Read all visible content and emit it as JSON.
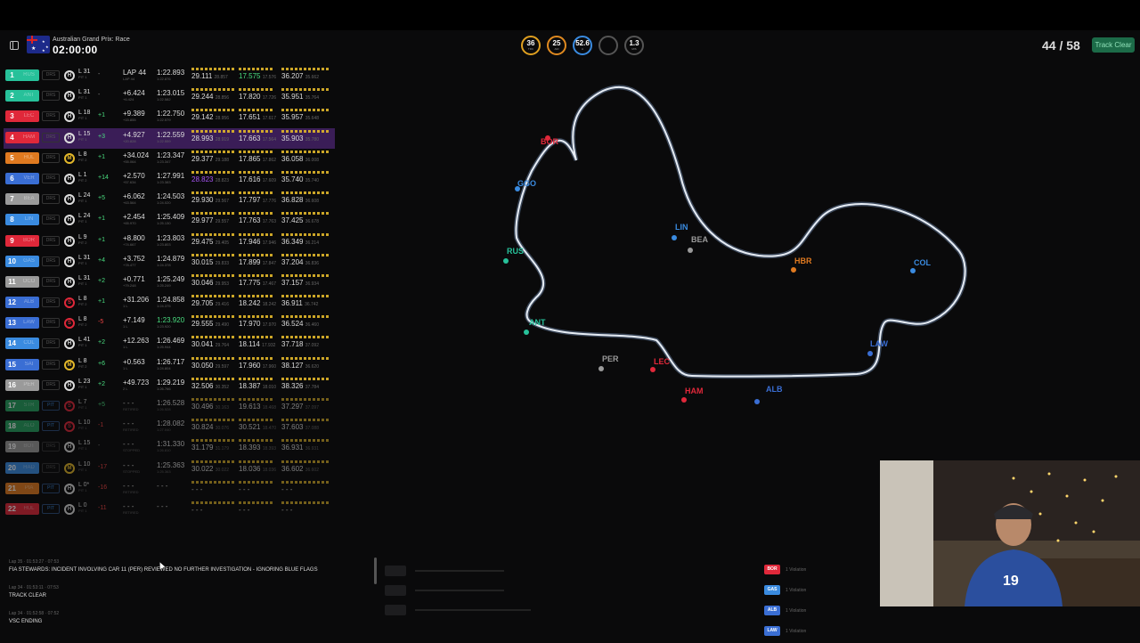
{
  "header": {
    "race_title": "Australian Grand Prix: Race",
    "clock": "02:00:00",
    "weather": [
      {
        "icon": "track-temp-icon",
        "value": "36",
        "unit": "TRC",
        "color": "#e0a020"
      },
      {
        "icon": "air-temp-icon",
        "value": "25",
        "unit": "AIR",
        "color": "#e08a20"
      },
      {
        "icon": "humidity-icon",
        "value": "52.6",
        "unit": "H",
        "color": "#3a8be0"
      },
      {
        "icon": "rain-icon",
        "value": "",
        "unit": "",
        "color": "#555555"
      },
      {
        "icon": "wind-icon",
        "value": "1.3",
        "unit": "M/S",
        "color": "#555555"
      }
    ],
    "laps": "44 / 58",
    "track_status": "Track Clear"
  },
  "drivers": [
    {
      "pos": "1",
      "code": "RUS",
      "color": "#27c19a",
      "drs": "DRS",
      "tyre": "H",
      "tyre_color": "#dddddd",
      "lap": "L 31",
      "lap_sub": "PIT 1",
      "delta": "-",
      "delta_color": "#888888",
      "gap": "LAP 44",
      "gap_sub": "LAP 44",
      "time": "1:22.893",
      "time_sub": "1:22.876",
      "s1": "29.111",
      "s1s": "28.857",
      "s2": "17.575",
      "s2s": "17.576",
      "s3": "36.207",
      "s3s": "35.662",
      "s2color": "#4ade80"
    },
    {
      "pos": "2",
      "code": "ANT",
      "color": "#27c19a",
      "drs": "DRS",
      "tyre": "H",
      "tyre_color": "#dddddd",
      "lap": "L 31",
      "lap_sub": "PIT 1",
      "delta": "-",
      "delta_color": "#888888",
      "gap": "+6.424",
      "gap_sub": "+6.424",
      "time": "1:23.015",
      "time_sub": "1:22.582",
      "s1": "29.244",
      "s1s": "28.856",
      "s2": "17.820",
      "s2s": "17.726",
      "s3": "35.951",
      "s3s": "35.764",
      "s2color": "#dddddd"
    },
    {
      "pos": "3",
      "code": "LEC",
      "color": "#e0283a",
      "drs": "DRS",
      "tyre": "H",
      "tyre_color": "#dddddd",
      "lap": "L 18",
      "lap_sub": "PIT 1",
      "delta": "+1",
      "delta_color": "#4ade80",
      "gap": "+9.389",
      "gap_sub": "+15.855",
      "time": "1:22.750",
      "time_sub": "1:22.579",
      "s1": "29.142",
      "s1s": "28.956",
      "s2": "17.651",
      "s2s": "17.617",
      "s3": "35.957",
      "s3s": "35.648",
      "s2color": "#dddddd"
    },
    {
      "pos": "4",
      "code": "HAM",
      "color": "#e0283a",
      "drs": "DRS",
      "tyre": "H",
      "tyre_color": "#dddddd",
      "lap": "L 15",
      "lap_sub": "PIT 1",
      "delta": "+3",
      "delta_color": "#4ade80",
      "gap": "+4.927",
      "gap_sub": "+20.828",
      "time": "1:22.559",
      "time_sub": "1:22.559",
      "s1": "28.993",
      "s1s": "28.919",
      "s2": "17.663",
      "s2s": "17.564",
      "s3": "35.903",
      "s3s": "35.780",
      "s2color": "#dddddd",
      "highlight": true
    },
    {
      "pos": "5",
      "code": "HUL",
      "color": "#e07a20",
      "drs": "DRS",
      "tyre": "M",
      "tyre_color": "#e2b72a",
      "lap": "L 8",
      "lap_sub": "PIT 2",
      "delta": "+1",
      "delta_color": "#4ade80",
      "gap": "+34.024",
      "gap_sub": "+55.064",
      "time": "1:23.347",
      "time_sub": "1:23.347",
      "s1": "29.377",
      "s1s": "29.188",
      "s2": "17.865",
      "s2s": "17.862",
      "s3": "36.058",
      "s3s": "36.008",
      "s2color": "#dddddd"
    },
    {
      "pos": "6",
      "code": "VER",
      "color": "#3a6ed4",
      "drs": "DRS",
      "tyre": "H",
      "tyre_color": "#dddddd",
      "lap": "L 1",
      "lap_sub": "PIT 2",
      "delta": "+14",
      "delta_color": "#4ade80",
      "gap": "+2.570",
      "gap_sub": "+57.634",
      "time": "1:27.991",
      "time_sub": "1:23.383",
      "s1": "28.823",
      "s1s": "28.823",
      "s2": "17.616",
      "s2s": "17.609",
      "s3": "35.740",
      "s3s": "35.740",
      "s2color": "#dddddd",
      "s1color": "#a855f7"
    },
    {
      "pos": "7",
      "code": "BEA",
      "color": "#9a9a9a",
      "drs": "DRS",
      "tyre": "H",
      "tyre_color": "#dddddd",
      "lap": "L 24",
      "lap_sub": "PIT 1",
      "delta": "+5",
      "delta_color": "#4ade80",
      "gap": "+6.062",
      "gap_sub": "+63.564",
      "time": "1:24.503",
      "time_sub": "1:24.020",
      "s1": "29.930",
      "s1s": "29.567",
      "s2": "17.797",
      "s2s": "17.776",
      "s3": "36.828",
      "s3s": "36.608",
      "s2color": "#dddddd"
    },
    {
      "pos": "8",
      "code": "LIN",
      "color": "#3a8be0",
      "drs": "DRS",
      "tyre": "H",
      "tyre_color": "#dddddd",
      "lap": "L 24",
      "lap_sub": "PIT 1",
      "delta": "+1",
      "delta_color": "#4ade80",
      "gap": "+2.454",
      "gap_sub": "+65.970",
      "time": "1:25.409",
      "time_sub": "1:25.130",
      "s1": "29.977",
      "s1s": "29.557",
      "s2": "17.763",
      "s2s": "17.763",
      "s3": "37.425",
      "s3s": "36.678",
      "s2color": "#dddddd"
    },
    {
      "pos": "9",
      "code": "BOR",
      "color": "#e0283a",
      "drs": "DRS",
      "tyre": "H",
      "tyre_color": "#dddddd",
      "lap": "L 9",
      "lap_sub": "PIT 2",
      "delta": "+1",
      "delta_color": "#4ade80",
      "gap": "+8.800",
      "gap_sub": "+74.667",
      "time": "1:23.803",
      "time_sub": "1:23.803",
      "s1": "29.475",
      "s1s": "29.405",
      "s2": "17.946",
      "s2s": "17.946",
      "s3": "36.349",
      "s3s": "36.214",
      "s2color": "#dddddd"
    },
    {
      "pos": "10",
      "code": "GAS",
      "color": "#3a8be0",
      "drs": "DRS",
      "tyre": "H",
      "tyre_color": "#dddddd",
      "lap": "L 31",
      "lap_sub": "PIT 1",
      "delta": "+4",
      "delta_color": "#4ade80",
      "gap": "+3.752",
      "gap_sub": "+78.477",
      "time": "1:24.879",
      "time_sub": "1:24.378",
      "s1": "30.015",
      "s1s": "29.833",
      "s2": "17.899",
      "s2s": "17.847",
      "s3": "37.204",
      "s3s": "36.836",
      "s2color": "#dddddd"
    },
    {
      "pos": "11",
      "code": "OCO",
      "color": "#9a9a9a",
      "drs": "DRS",
      "tyre": "H",
      "tyre_color": "#dddddd",
      "lap": "L 31",
      "lap_sub": "PIT 1",
      "delta": "+2",
      "delta_color": "#4ade80",
      "gap": "+0.771",
      "gap_sub": "+79.248",
      "time": "1:25.249",
      "time_sub": "1:25.249",
      "s1": "30.046",
      "s1s": "29.953",
      "s2": "17.775",
      "s2s": "17.467",
      "s3": "37.157",
      "s3s": "36.934",
      "s2color": "#dddddd"
    },
    {
      "pos": "12",
      "code": "ALB",
      "color": "#3a6ed4",
      "drs": "DRS",
      "tyre": "S",
      "tyre_color": "#e0283a",
      "lap": "L 8",
      "lap_sub": "PIT 2",
      "delta": "+1",
      "delta_color": "#4ade80",
      "gap": "+31.206",
      "gap_sub": "1 L",
      "time": "1:24.858",
      "time_sub": "1:24.375",
      "s1": "29.705",
      "s1s": "29.416",
      "s2": "18.242",
      "s2s": "18.242",
      "s3": "36.911",
      "s3s": "36.742",
      "s2color": "#dddddd"
    },
    {
      "pos": "13",
      "code": "LAW",
      "color": "#3a6ed4",
      "drs": "DRS",
      "tyre": "S",
      "tyre_color": "#e0283a",
      "lap": "L 8",
      "lap_sub": "PIT 2",
      "delta": "-5",
      "delta_color": "#ef4444",
      "gap": "+7.149",
      "gap_sub": "1 L",
      "time": "1:23.920",
      "time_sub": "1:23.920",
      "s1": "29.555",
      "s1s": "29.490",
      "s2": "17.970",
      "s2s": "17.970",
      "s3": "36.524",
      "s3s": "36.460",
      "s2color": "#dddddd",
      "timecolor": "#4ade80"
    },
    {
      "pos": "14",
      "code": "COL",
      "color": "#3a8be0",
      "drs": "DRS",
      "tyre": "H",
      "tyre_color": "#dddddd",
      "lap": "L 41",
      "lap_sub": "PIT 1",
      "delta": "+2",
      "delta_color": "#4ade80",
      "gap": "+12.263",
      "gap_sub": "1 L",
      "time": "1:26.469",
      "time_sub": "1:25.944",
      "s1": "30.041",
      "s1s": "29.764",
      "s2": "18.114",
      "s2s": "17.932",
      "s3": "37.718",
      "s3s": "37.092",
      "s2color": "#dddddd"
    },
    {
      "pos": "15",
      "code": "SAI",
      "color": "#3a6ed4",
      "drs": "DRS",
      "tyre": "M",
      "tyre_color": "#e2b72a",
      "lap": "L 8",
      "lap_sub": "PIT 2",
      "delta": "+6",
      "delta_color": "#4ade80",
      "gap": "+0.563",
      "gap_sub": "1 L",
      "time": "1:26.717",
      "time_sub": "1:24.804",
      "s1": "30.050",
      "s1s": "29.597",
      "s2": "17.960",
      "s2s": "17.960",
      "s3": "38.127",
      "s3s": "36.620",
      "s2color": "#dddddd"
    },
    {
      "pos": "16",
      "code": "PER",
      "color": "#9a9a9a",
      "drs": "DRS",
      "tyre": "H",
      "tyre_color": "#dddddd",
      "lap": "L 23",
      "lap_sub": "PIT 1",
      "delta": "+2",
      "delta_color": "#4ade80",
      "gap": "+49.723",
      "gap_sub": "2 L",
      "time": "1:29.219",
      "time_sub": "1:26.766",
      "s1": "32.506",
      "s1s": "30.352",
      "s2": "18.387",
      "s2s": "18.010",
      "s3": "38.326",
      "s3s": "37.784",
      "s2color": "#dddddd"
    },
    {
      "pos": "17",
      "code": "STR",
      "color": "#27a060",
      "drs": "PIT",
      "tyre": "S",
      "tyre_color": "#e0283a",
      "lap": "L 7",
      "lap_sub": "PIT 1",
      "delta": "+5",
      "delta_color": "#4ade80",
      "gap": "- - -",
      "gap_sub": "RETIRED",
      "time": "1:26.528",
      "time_sub": "1:26.528",
      "s1": "30.496",
      "s1s": "30.163",
      "s2": "19.613",
      "s2s": "18.468",
      "s3": "37.297",
      "s3s": "37.097",
      "s2color": "#dddddd",
      "dim": true
    },
    {
      "pos": "18",
      "code": "ALO",
      "color": "#27a060",
      "drs": "PIT",
      "tyre": "S",
      "tyre_color": "#e0283a",
      "lap": "L 10",
      "lap_sub": "PIT 1",
      "delta": "-1",
      "delta_color": "#ef4444",
      "gap": "- - -",
      "gap_sub": "RETIRED",
      "time": "1:28.082",
      "time_sub": "1:27.040",
      "s1": "30.824",
      "s1s": "30.076",
      "s2": "30.521",
      "s2s": "18.470",
      "s3": "37.603",
      "s3s": "37.088",
      "s2color": "#dddddd",
      "dim": true
    },
    {
      "pos": "19",
      "code": "BOT",
      "color": "#9a9a9a",
      "drs": "DRS",
      "tyre": "H",
      "tyre_color": "#dddddd",
      "lap": "L 15",
      "lap_sub": "PIT 1",
      "delta": "-",
      "delta_color": "#888888",
      "gap": "- - -",
      "gap_sub": "STOPPED",
      "time": "1:31.330",
      "time_sub": "1:26.810",
      "s1": "31.179",
      "s1s": "31.179",
      "s2": "18.393",
      "s2s": "18.393",
      "s3": "36.931",
      "s3s": "36.931",
      "s2color": "#dddddd",
      "dim": true
    },
    {
      "pos": "20",
      "code": "HAD",
      "color": "#3a8be0",
      "drs": "DRS",
      "tyre": "M",
      "tyre_color": "#e2b72a",
      "lap": "L 10",
      "lap_sub": "PIT 1",
      "delta": "-17",
      "delta_color": "#ef4444",
      "gap": "- - -",
      "gap_sub": "STOPPED",
      "time": "1:25.363",
      "time_sub": "1:25.363",
      "s1": "30.022",
      "s1s": "30.022",
      "s2": "18.036",
      "s2s": "18.036",
      "s3": "36.602",
      "s3s": "36.602",
      "s2color": "#dddddd",
      "dim": true
    },
    {
      "pos": "21",
      "code": "PIA",
      "color": "#e07a20",
      "drs": "PIT",
      "tyre": "H",
      "tyre_color": "#dddddd",
      "lap": "L 0*",
      "lap_sub": "PIT 1",
      "delta": "-16",
      "delta_color": "#ef4444",
      "gap": "- - -",
      "gap_sub": "RETIRED",
      "time": "- - -",
      "time_sub": "",
      "s1": "- - -",
      "s1s": "",
      "s2": "- - -",
      "s2s": "",
      "s3": "- - -",
      "s3s": "",
      "s2color": "#dddddd",
      "dim": true
    },
    {
      "pos": "22",
      "code": "HUL",
      "color": "#e0283a",
      "drs": "PIT",
      "tyre": "H",
      "tyre_color": "#dddddd",
      "lap": "L 0",
      "lap_sub": "PIT 1",
      "delta": "-11",
      "delta_color": "#ef4444",
      "gap": "- - -",
      "gap_sub": "RETIRED",
      "time": "- - -",
      "time_sub": "",
      "s1": "- - -",
      "s1s": "",
      "s2": "- - -",
      "s2s": "",
      "s3": "- - -",
      "s3s": "",
      "s2color": "#dddddd",
      "dim": true
    }
  ],
  "track_labels": [
    {
      "code": "BOR",
      "color": "#e0283a"
    },
    {
      "code": "GGO",
      "color": "#3a8be0"
    },
    {
      "code": "RUS",
      "color": "#27c19a"
    },
    {
      "code": "ANT",
      "color": "#27c19a"
    },
    {
      "code": "PER",
      "color": "#9a9a9a"
    },
    {
      "code": "LEC",
      "color": "#e0283a"
    },
    {
      "code": "HAM",
      "color": "#e0283a"
    },
    {
      "code": "ALB",
      "color": "#3a6ed4"
    },
    {
      "code": "LIN",
      "color": "#3a8be0"
    },
    {
      "code": "BEA",
      "color": "#9a9a9a"
    },
    {
      "code": "HBR",
      "color": "#e07a20"
    },
    {
      "code": "COL",
      "color": "#3a8be0"
    },
    {
      "code": "LAW",
      "color": "#3a6ed4"
    }
  ],
  "race_control": [
    {
      "meta": "Lap 35 · 01:53:27 · 07:53",
      "msg": "FIA STEWARDS: INCIDENT INVOLVING CAR 11 (PER) REVIEWED NO FURTHER INVESTIGATION - IGNORING BLUE FLAGS"
    },
    {
      "meta": "Lap 34 · 01:53:11 · 07:53",
      "msg": "TRACK CLEAR"
    },
    {
      "meta": "Lap 34 · 01:52:58 · 07:52",
      "msg": "VSC ENDING"
    }
  ],
  "violations": [
    {
      "code": "BOR",
      "color": "#e0283a",
      "text": "1 Violation"
    },
    {
      "code": "GAS",
      "color": "#3a8be0",
      "text": "1 Violation"
    },
    {
      "code": "ALB",
      "color": "#3a6ed4",
      "text": "1 Violation"
    },
    {
      "code": "LAW",
      "color": "#3a6ed4",
      "text": "1 Violation"
    }
  ]
}
